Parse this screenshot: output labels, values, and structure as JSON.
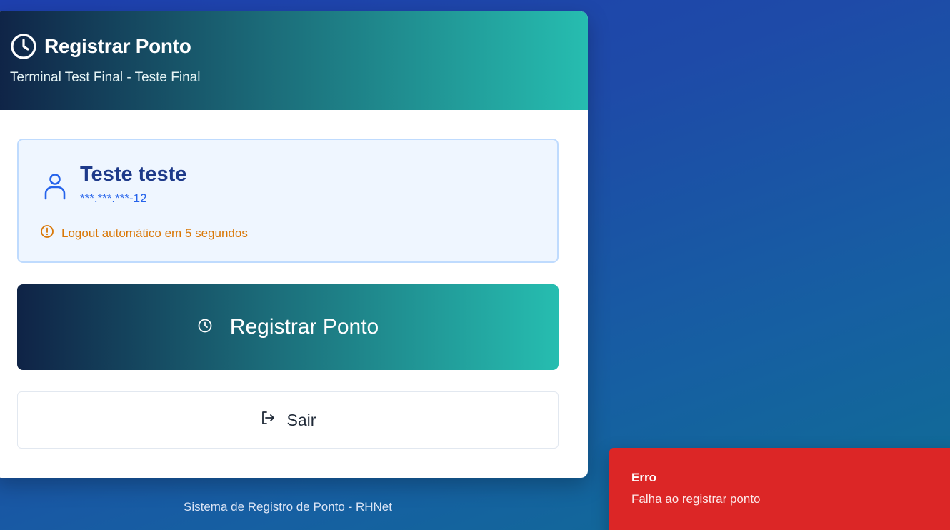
{
  "header": {
    "title": "Registrar Ponto",
    "subtitle": "Terminal Test Final - Teste Final",
    "icon": "clock-icon"
  },
  "user": {
    "name": "Teste teste",
    "cpf": "***.***.***-12",
    "icon": "user-icon",
    "logout_warning": "Logout automático em 5 segundos",
    "warning_icon": "alert-circle-icon"
  },
  "actions": {
    "register_label": "Registrar Ponto",
    "register_icon": "clock-icon",
    "exit_label": "Sair",
    "exit_icon": "logout-icon"
  },
  "footer": {
    "text": "Sistema de Registro de Ponto - RHNet"
  },
  "toast": {
    "title": "Erro",
    "message": "Falha ao registrar ponto"
  },
  "colors": {
    "background": "#1e40af",
    "header_gradient_start": "#0f2346",
    "header_gradient_end": "#26bdb0",
    "user_box_bg": "#eff6ff",
    "user_name": "#1e3a8a",
    "warning": "#d97706",
    "error": "#dc2626"
  }
}
